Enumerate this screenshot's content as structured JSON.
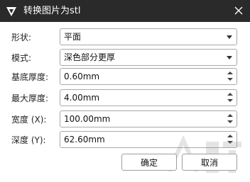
{
  "window": {
    "title": "转换图片为stl",
    "icon": "app-logo-icon",
    "close_icon": "close-icon"
  },
  "form": {
    "shape": {
      "label": "形状:",
      "value": "平面"
    },
    "mode": {
      "label": "模式:",
      "value": "深色部分更厚"
    },
    "base_thickness": {
      "label": "基底厚度:",
      "value": "0.60mm"
    },
    "max_thickness": {
      "label": "最大厚度:",
      "value": "4.00mm"
    },
    "width": {
      "label": "宽度 (X):",
      "value": "100.00mm"
    },
    "depth": {
      "label": "深度 (Y):",
      "value": "62.60mm"
    }
  },
  "buttons": {
    "ok": "确定",
    "cancel": "取消"
  },
  "colors": {
    "titlebar": "#2a2a2a",
    "border": "#a9a9a9"
  }
}
